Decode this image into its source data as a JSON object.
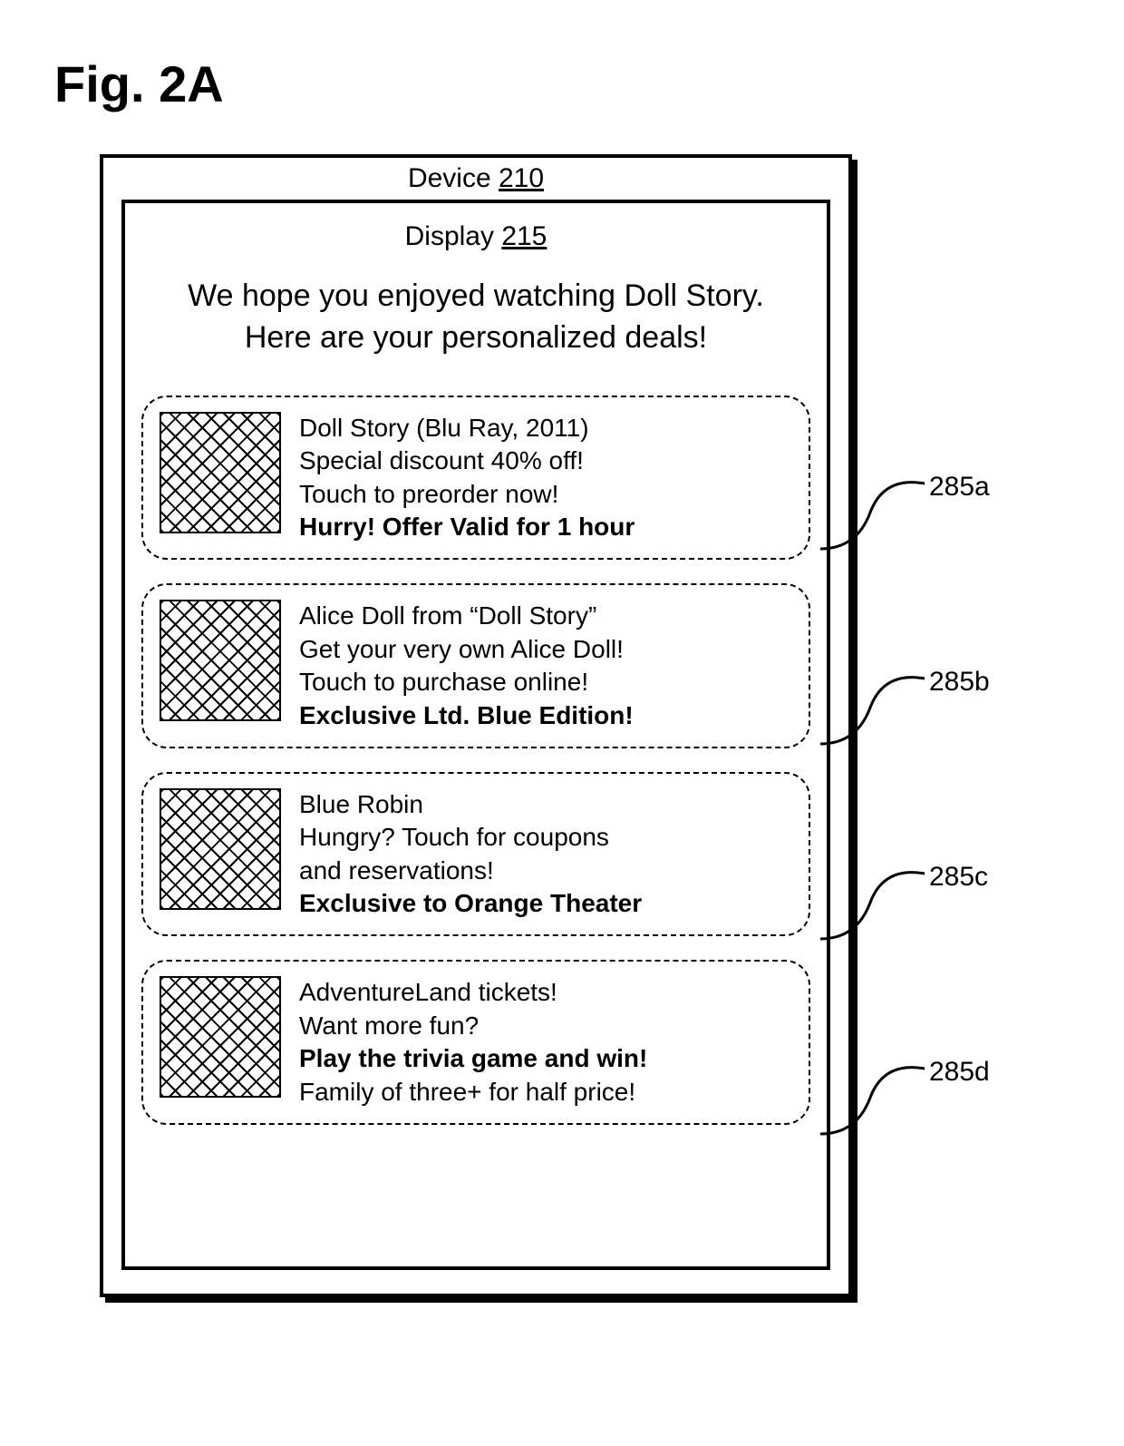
{
  "figure_label": "Fig. 2A",
  "device": {
    "label_prefix": "Device ",
    "label_num": "210"
  },
  "display": {
    "label_prefix": "Display ",
    "label_num": "215"
  },
  "welcome_text": "We hope you enjoyed watching Doll Story. Here are your personalized deals!",
  "cards": [
    {
      "id": "285a",
      "lines": [
        {
          "text": "Doll Story (Blu Ray, 2011)",
          "bold": false
        },
        {
          "text": "Special discount 40% off!",
          "bold": false
        },
        {
          "text": "Touch to preorder now!",
          "bold": false
        },
        {
          "text": "Hurry! Offer Valid for 1 hour",
          "bold": true
        }
      ]
    },
    {
      "id": "285b",
      "lines": [
        {
          "text": "Alice Doll from “Doll Story”",
          "bold": false
        },
        {
          "text": "Get your very own Alice Doll!",
          "bold": false
        },
        {
          "text": "Touch to purchase online!",
          "bold": false
        },
        {
          "text": "Exclusive Ltd. Blue Edition!",
          "bold": true
        }
      ]
    },
    {
      "id": "285c",
      "lines": [
        {
          "text": "Blue Robin",
          "bold": false
        },
        {
          "text": "Hungry? Touch for coupons",
          "bold": false
        },
        {
          "text": "and reservations!",
          "bold": false
        },
        {
          "text": "Exclusive to Orange Theater",
          "bold": true
        }
      ]
    },
    {
      "id": "285d",
      "lines": [
        {
          "text": "AdventureLand tickets!",
          "bold": false
        },
        {
          "text": "Want more fun?",
          "bold": false
        },
        {
          "text": "Play the trivia game and win!",
          "bold": true
        },
        {
          "text": "Family of three+ for half price!",
          "bold": false
        }
      ]
    }
  ],
  "callouts": [
    {
      "ref": "285a",
      "text": "285a"
    },
    {
      "ref": "285b",
      "text": "285b"
    },
    {
      "ref": "285c",
      "text": "285c"
    },
    {
      "ref": "285d",
      "text": "285d"
    }
  ]
}
